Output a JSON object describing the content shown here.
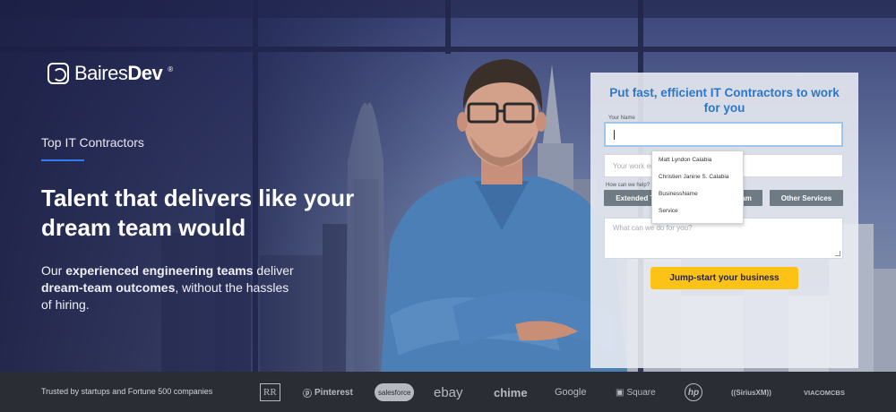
{
  "brand": {
    "logo_word_regular": "Baires",
    "logo_word_bold": "Dev",
    "logo_reg": "®"
  },
  "hero": {
    "eyebrow": "Top IT Contractors",
    "headline": "Talent that delivers like your dream team would",
    "subcopy_parts": [
      {
        "text": "Our ",
        "bold": false
      },
      {
        "text": "experienced engineering teams",
        "bold": true
      },
      {
        "text": " deliver ",
        "bold": false
      },
      {
        "text": "dream-team outcomes",
        "bold": true
      },
      {
        "text": ", without the hassles of hiring.",
        "bold": false
      }
    ]
  },
  "form": {
    "title": "Put fast, efficient IT Contractors to work for you",
    "name_label": "Your Name",
    "name_value": "",
    "email_placeholder": "Your work email",
    "help_label": "How can we help?",
    "help_options": [
      "Extended Team",
      "Dedicated Team",
      "Other Services"
    ],
    "message_placeholder": "What can we do for you?",
    "cta_label": "Jump-start your business"
  },
  "autocomplete": {
    "items": [
      "Matt Lyndon Calabia",
      "Christien Janine S. Calabia",
      "BusinessName",
      "Service"
    ]
  },
  "footer": {
    "trusted_text": "Trusted by startups and Fortune 500 companies",
    "brands": [
      {
        "name": "Rolls-Royce",
        "label": "RR"
      },
      {
        "name": "Pinterest",
        "label": "Pinterest"
      },
      {
        "name": "Salesforce",
        "label": "salesforce"
      },
      {
        "name": "eBay",
        "label": "ebay"
      },
      {
        "name": "Chime",
        "label": "chime"
      },
      {
        "name": "Google",
        "label": "Google"
      },
      {
        "name": "Square",
        "label": "Square"
      },
      {
        "name": "HP",
        "label": "hp"
      },
      {
        "name": "SiriusXM",
        "label": "((SiriusXM))"
      },
      {
        "name": "ViacomCBS",
        "label": "VIACOMCBS"
      }
    ]
  },
  "colors": {
    "accent_blue": "#2d77c7",
    "cta_yellow": "#fcc316",
    "footer_bg": "#2a2d34",
    "hero_navy": "#1e2246"
  }
}
